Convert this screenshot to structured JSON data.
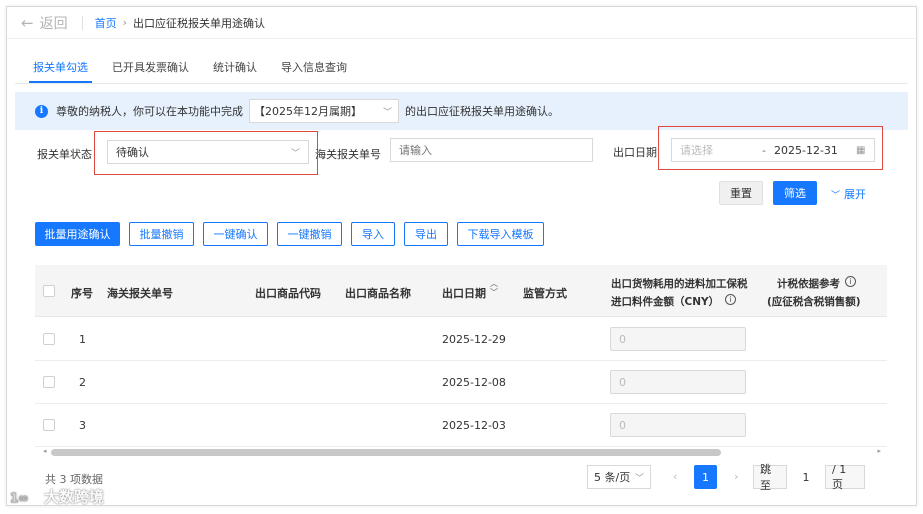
{
  "header": {
    "back_label": "返回",
    "breadcrumb": {
      "home": "首页",
      "separator": "›",
      "current": "出口应征税报关单用途确认"
    }
  },
  "tabs": [
    {
      "label": "报关单勾选",
      "active": true
    },
    {
      "label": "已开具发票确认",
      "active": false
    },
    {
      "label": "统计确认",
      "active": false
    },
    {
      "label": "导入信息查询",
      "active": false
    }
  ],
  "notice": {
    "prefix": "尊敬的纳税人，你可以在本功能中完成",
    "period": "【2025年12月属期】",
    "suffix": "的出口应征税报关单用途确认。"
  },
  "filters": {
    "status_label": "报关单状态",
    "status_value": "待确认",
    "customs_label": "海关报关单号",
    "customs_placeholder": "请输入",
    "date_label": "出口日期",
    "date_start_placeholder": "请选择",
    "date_sep": "-",
    "date_end": "2025-12-31"
  },
  "filter_actions": {
    "reset": "重置",
    "search": "筛选",
    "expand": "展开"
  },
  "toolbar": {
    "batch_confirm": "批量用途确认",
    "batch_revoke": "批量撤销",
    "one_confirm": "一键确认",
    "one_revoke": "一键撤销",
    "import": "导入",
    "export": "导出",
    "download_template": "下载导入模板"
  },
  "table": {
    "columns": {
      "seq": "序号",
      "customs_no": "海关报关单号",
      "product_code": "出口商品代码",
      "product_name": "出口商品名称",
      "export_date": "出口日期",
      "supervision": "监管方式",
      "amount_line1": "出口货物耗用的进料加工保税",
      "amount_line2": "进口料件金额（CNY）",
      "basis_line1": "计税依据参考",
      "basis_line2": "(应征税含税销售额)"
    },
    "rows": [
      {
        "seq": "1",
        "export_date": "2025-12-29",
        "amount": "0"
      },
      {
        "seq": "2",
        "export_date": "2025-12-08",
        "amount": "0"
      },
      {
        "seq": "3",
        "export_date": "2025-12-03",
        "amount": "0"
      }
    ]
  },
  "pagination": {
    "total": "共 3 项数据",
    "page_size": "5 条/页",
    "current_page": "1",
    "goto_label": "跳至",
    "goto_value": "1",
    "total_pages": "/ 1 页"
  },
  "watermark": "大数跨境",
  "colors": {
    "primary": "#1677ff",
    "highlight_box": "#e0493f",
    "notice_bg": "#e6f1fd"
  }
}
